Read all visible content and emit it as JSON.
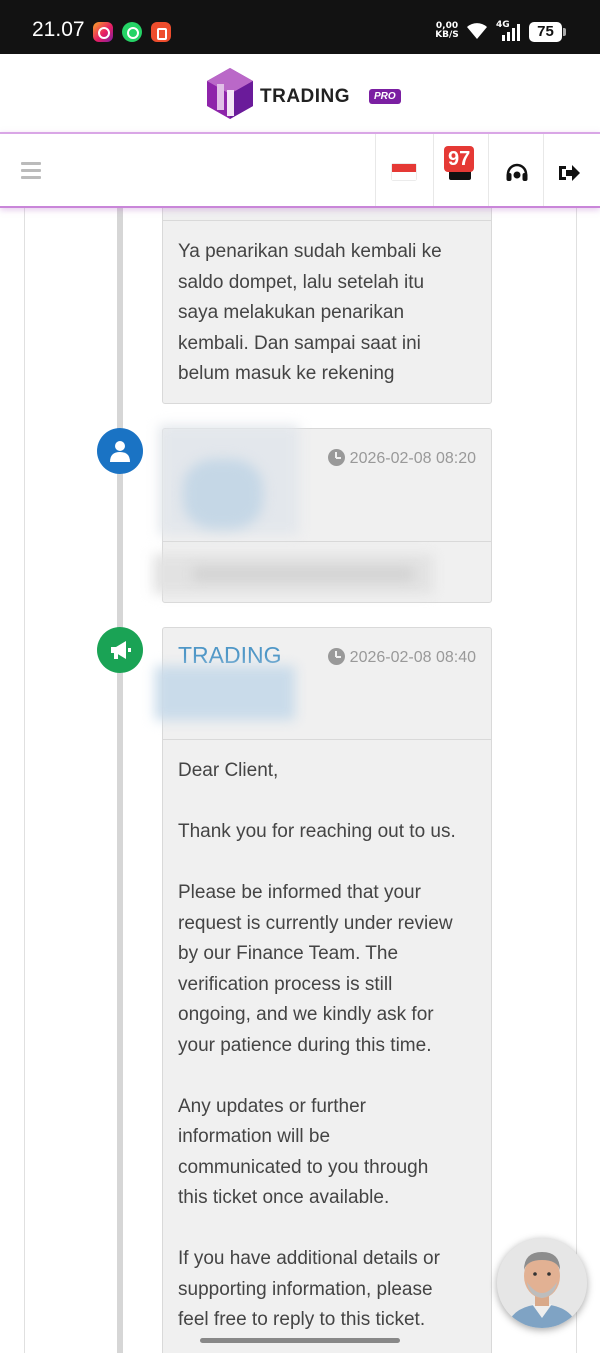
{
  "status_bar": {
    "time": "21.07",
    "net_speed_value": "0,00",
    "net_speed_unit": "KB/S",
    "network": "4G",
    "battery": "75"
  },
  "brand": {
    "name": "TRADING",
    "tag": "PRO"
  },
  "nav": {
    "notification_count": "97"
  },
  "messages": [
    {
      "author": "",
      "time": "",
      "body": "Ya penarikan sudah kembali ke\nsaldo dompet, lalu setelah itu\nsaya melakukan penarikan\nkembali. Dan sampai saat ini\nbelum masuk ke rekening"
    },
    {
      "author": "",
      "time": "2026-02-08 08:20",
      "body": ""
    },
    {
      "author": "TRADING",
      "time": "2026-02-08 08:40",
      "body": "Dear Client,\n\nThank you for reaching out to us.\n\nPlease be informed that your\nrequest is currently under review\nby our Finance Team. The\nverification process is still\nongoing, and we kindly ask for\nyour patience during this time.\n\nAny updates or further\ninformation will be\ncommunicated to you through\nthis ticket once available.\n\nIf you have additional details or\nsupporting information, please\nfeel free to reply to this ticket."
    }
  ],
  "colors": {
    "user_avatar": "#1a73c4",
    "staff_avatar": "#1aa355",
    "author_link": "#4f97c7",
    "badge": "#e53935",
    "accent": "#7b1fa2"
  }
}
